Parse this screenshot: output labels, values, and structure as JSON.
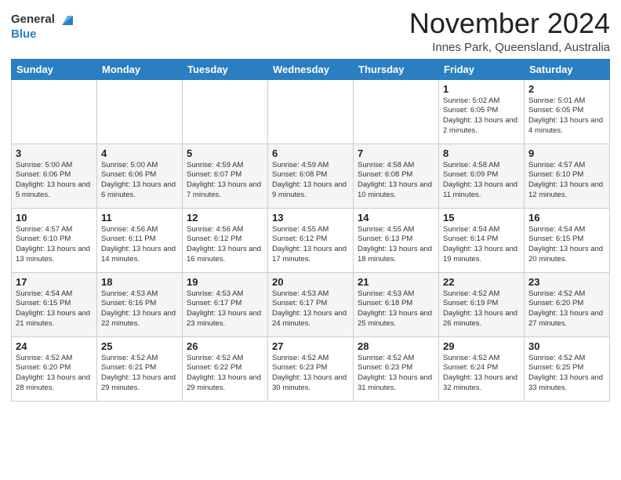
{
  "logo": {
    "line1": "General",
    "line2": "Blue"
  },
  "title": "November 2024",
  "location": "Innes Park, Queensland, Australia",
  "days_of_week": [
    "Sunday",
    "Monday",
    "Tuesday",
    "Wednesday",
    "Thursday",
    "Friday",
    "Saturday"
  ],
  "weeks": [
    [
      {
        "day": "",
        "info": ""
      },
      {
        "day": "",
        "info": ""
      },
      {
        "day": "",
        "info": ""
      },
      {
        "day": "",
        "info": ""
      },
      {
        "day": "",
        "info": ""
      },
      {
        "day": "1",
        "info": "Sunrise: 5:02 AM\nSunset: 6:05 PM\nDaylight: 13 hours and 2 minutes."
      },
      {
        "day": "2",
        "info": "Sunrise: 5:01 AM\nSunset: 6:05 PM\nDaylight: 13 hours and 4 minutes."
      }
    ],
    [
      {
        "day": "3",
        "info": "Sunrise: 5:00 AM\nSunset: 6:06 PM\nDaylight: 13 hours and 5 minutes."
      },
      {
        "day": "4",
        "info": "Sunrise: 5:00 AM\nSunset: 6:06 PM\nDaylight: 13 hours and 6 minutes."
      },
      {
        "day": "5",
        "info": "Sunrise: 4:59 AM\nSunset: 6:07 PM\nDaylight: 13 hours and 7 minutes."
      },
      {
        "day": "6",
        "info": "Sunrise: 4:59 AM\nSunset: 6:08 PM\nDaylight: 13 hours and 9 minutes."
      },
      {
        "day": "7",
        "info": "Sunrise: 4:58 AM\nSunset: 6:08 PM\nDaylight: 13 hours and 10 minutes."
      },
      {
        "day": "8",
        "info": "Sunrise: 4:58 AM\nSunset: 6:09 PM\nDaylight: 13 hours and 11 minutes."
      },
      {
        "day": "9",
        "info": "Sunrise: 4:57 AM\nSunset: 6:10 PM\nDaylight: 13 hours and 12 minutes."
      }
    ],
    [
      {
        "day": "10",
        "info": "Sunrise: 4:57 AM\nSunset: 6:10 PM\nDaylight: 13 hours and 13 minutes."
      },
      {
        "day": "11",
        "info": "Sunrise: 4:56 AM\nSunset: 6:11 PM\nDaylight: 13 hours and 14 minutes."
      },
      {
        "day": "12",
        "info": "Sunrise: 4:56 AM\nSunset: 6:12 PM\nDaylight: 13 hours and 16 minutes."
      },
      {
        "day": "13",
        "info": "Sunrise: 4:55 AM\nSunset: 6:12 PM\nDaylight: 13 hours and 17 minutes."
      },
      {
        "day": "14",
        "info": "Sunrise: 4:55 AM\nSunset: 6:13 PM\nDaylight: 13 hours and 18 minutes."
      },
      {
        "day": "15",
        "info": "Sunrise: 4:54 AM\nSunset: 6:14 PM\nDaylight: 13 hours and 19 minutes."
      },
      {
        "day": "16",
        "info": "Sunrise: 4:54 AM\nSunset: 6:15 PM\nDaylight: 13 hours and 20 minutes."
      }
    ],
    [
      {
        "day": "17",
        "info": "Sunrise: 4:54 AM\nSunset: 6:15 PM\nDaylight: 13 hours and 21 minutes."
      },
      {
        "day": "18",
        "info": "Sunrise: 4:53 AM\nSunset: 6:16 PM\nDaylight: 13 hours and 22 minutes."
      },
      {
        "day": "19",
        "info": "Sunrise: 4:53 AM\nSunset: 6:17 PM\nDaylight: 13 hours and 23 minutes."
      },
      {
        "day": "20",
        "info": "Sunrise: 4:53 AM\nSunset: 6:17 PM\nDaylight: 13 hours and 24 minutes."
      },
      {
        "day": "21",
        "info": "Sunrise: 4:53 AM\nSunset: 6:18 PM\nDaylight: 13 hours and 25 minutes."
      },
      {
        "day": "22",
        "info": "Sunrise: 4:52 AM\nSunset: 6:19 PM\nDaylight: 13 hours and 26 minutes."
      },
      {
        "day": "23",
        "info": "Sunrise: 4:52 AM\nSunset: 6:20 PM\nDaylight: 13 hours and 27 minutes."
      }
    ],
    [
      {
        "day": "24",
        "info": "Sunrise: 4:52 AM\nSunset: 6:20 PM\nDaylight: 13 hours and 28 minutes."
      },
      {
        "day": "25",
        "info": "Sunrise: 4:52 AM\nSunset: 6:21 PM\nDaylight: 13 hours and 29 minutes."
      },
      {
        "day": "26",
        "info": "Sunrise: 4:52 AM\nSunset: 6:22 PM\nDaylight: 13 hours and 29 minutes."
      },
      {
        "day": "27",
        "info": "Sunrise: 4:52 AM\nSunset: 6:23 PM\nDaylight: 13 hours and 30 minutes."
      },
      {
        "day": "28",
        "info": "Sunrise: 4:52 AM\nSunset: 6:23 PM\nDaylight: 13 hours and 31 minutes."
      },
      {
        "day": "29",
        "info": "Sunrise: 4:52 AM\nSunset: 6:24 PM\nDaylight: 13 hours and 32 minutes."
      },
      {
        "day": "30",
        "info": "Sunrise: 4:52 AM\nSunset: 6:25 PM\nDaylight: 13 hours and 33 minutes."
      }
    ]
  ]
}
